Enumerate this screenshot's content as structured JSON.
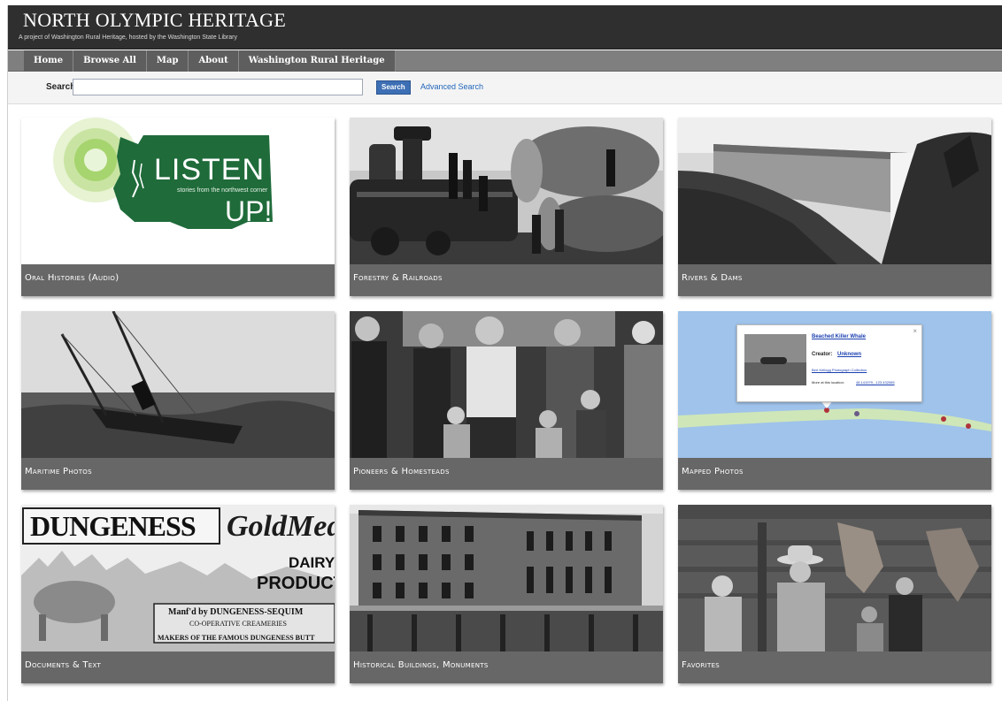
{
  "header": {
    "title": "NORTH OLYMPIC HERITAGE",
    "subtitle": "A project of Washington Rural Heritage, hosted by the Washington State Library"
  },
  "nav": {
    "items": [
      {
        "label": "Home"
      },
      {
        "label": "Browse All"
      },
      {
        "label": "Map"
      },
      {
        "label": "About"
      },
      {
        "label": "Washington Rural Heritage"
      }
    ]
  },
  "search": {
    "label": "Search",
    "value": "",
    "button_label": "Search",
    "advanced_label": "Advanced Search"
  },
  "tiles": [
    {
      "label": "Oral Histories (Audio)"
    },
    {
      "label": "Forestry & Railroads"
    },
    {
      "label": "Rivers & Dams"
    },
    {
      "label": "Maritime Photos"
    },
    {
      "label": "Pioneers & Homesteads"
    },
    {
      "label": "Mapped Photos"
    },
    {
      "label": "Documents & Text"
    },
    {
      "label": "Historical Buildings, Monuments"
    },
    {
      "label": "Favorites"
    }
  ],
  "listen_up": {
    "word1": "LISTEN",
    "tagline": "stories from the northwest corner",
    "word2": "UP!"
  },
  "map_popup": {
    "title": "Beached Killer Whale",
    "creator_label": "Creator:",
    "creator_value": "Unknown",
    "collection": "Bert Kellogg Photograph Collection",
    "location_label": "More at this location:",
    "location_value": "48.141979, -123.432065",
    "close": "×"
  },
  "documents_tile": {
    "word1": "DUNGENESS",
    "word2": "GoldMed",
    "line1": "DAIRY",
    "line2": "PRODUCT",
    "line3": "Manf'd by DUNGENESS-SEQUIM",
    "line4": "CO-OPERATIVE CREAMERIES",
    "line5": "MAKERS OF THE FAMOUS DUNGENESS BUTT"
  },
  "colors": {
    "header_bg": "#2f2f2f",
    "nav_bg": "#5e5e5e",
    "tile_label_bg": "#676767",
    "listen_green": "#1f6b3a",
    "link_blue": "#2266bb"
  }
}
